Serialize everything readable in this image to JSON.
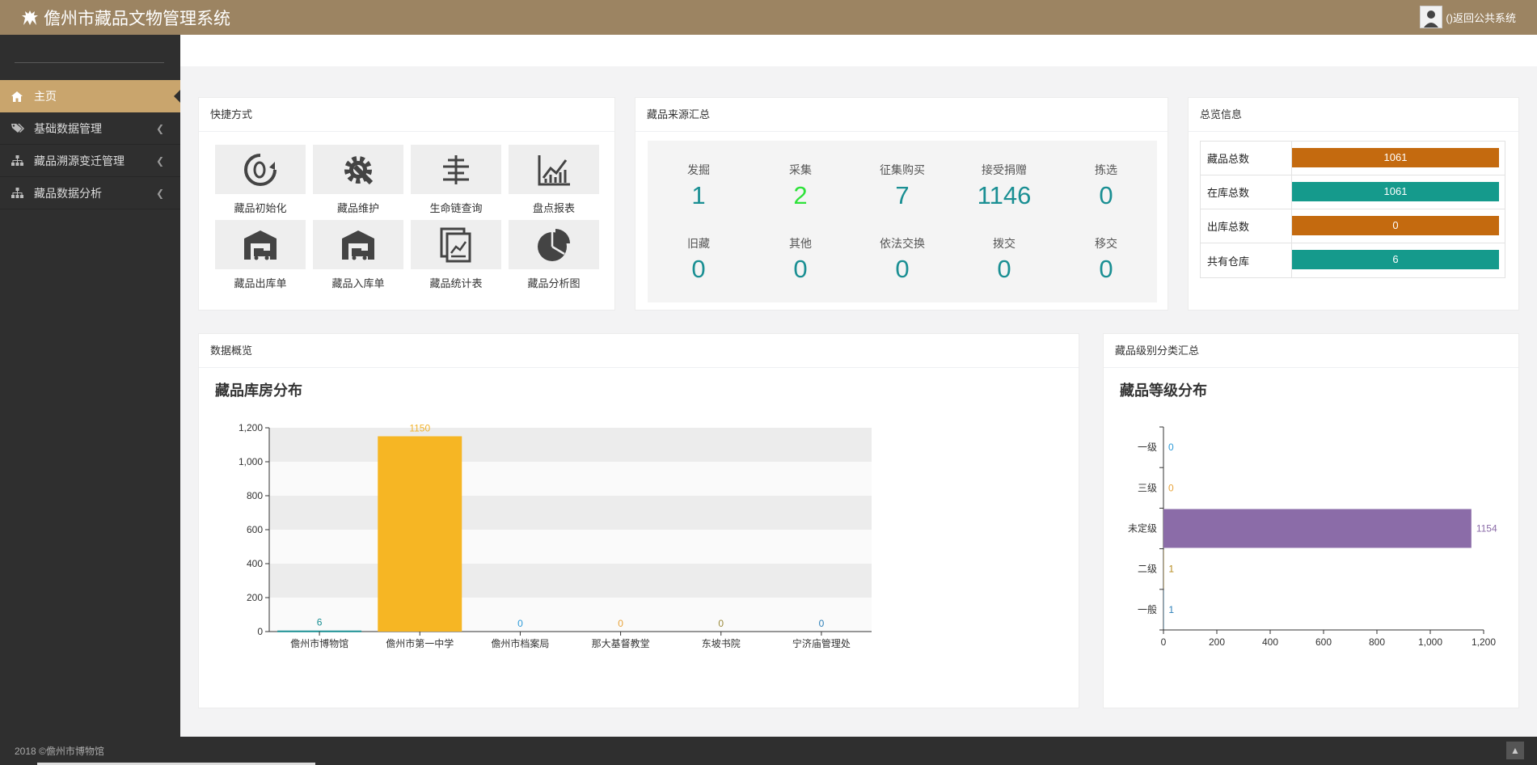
{
  "header": {
    "title": "儋州市藏品文物管理系统",
    "return_label": "()返回公共系统"
  },
  "sidebar": {
    "items": [
      {
        "label": "主页",
        "icon": "home-icon",
        "active": true
      },
      {
        "label": "基础数据管理",
        "icon": "tags-icon"
      },
      {
        "label": "藏品溯源变迁管理",
        "icon": "sitemap-icon"
      },
      {
        "label": "藏品数据分析",
        "icon": "sitemap-icon"
      }
    ]
  },
  "quick": {
    "title": "快捷方式",
    "items": [
      {
        "label": "藏品初始化",
        "icon": "reset-icon"
      },
      {
        "label": "藏品维护",
        "icon": "gear-wrench-icon"
      },
      {
        "label": "生命链查询",
        "icon": "align-center-icon"
      },
      {
        "label": "盘点报表",
        "icon": "line-chart-icon"
      },
      {
        "label": "藏品出库单",
        "icon": "warehouse-truck-icon"
      },
      {
        "label": "藏品入库单",
        "icon": "warehouse-truck-icon"
      },
      {
        "label": "藏品统计表",
        "icon": "documents-icon"
      },
      {
        "label": "藏品分析图",
        "icon": "pie-chart-icon"
      }
    ]
  },
  "source": {
    "title": "藏品来源汇总",
    "items": [
      {
        "label": "发掘",
        "value": "1"
      },
      {
        "label": "采集",
        "value": "2"
      },
      {
        "label": "征集购买",
        "value": "7"
      },
      {
        "label": "接受捐赠",
        "value": "1146"
      },
      {
        "label": "拣选",
        "value": "0"
      },
      {
        "label": "旧藏",
        "value": "0"
      },
      {
        "label": "其他",
        "value": "0"
      },
      {
        "label": "依法交换",
        "value": "0"
      },
      {
        "label": "拨交",
        "value": "0"
      },
      {
        "label": "移交",
        "value": "0"
      }
    ],
    "highlight_color": "#2ee23a",
    "value_color": "#1a8f93"
  },
  "overview": {
    "title": "总览信息",
    "rows": [
      {
        "label": "藏品总数",
        "value": "1061",
        "color": "#c46a0f"
      },
      {
        "label": "在库总数",
        "value": "1061",
        "color": "#159a8c"
      },
      {
        "label": "出库总数",
        "value": "0",
        "color": "#c46a0f"
      },
      {
        "label": "共有仓库",
        "value": "6",
        "color": "#159a8c"
      }
    ]
  },
  "data_overview": {
    "title": "数据概览",
    "chart_title": "藏品库房分布"
  },
  "level_summary": {
    "title": "藏品级别分类汇总",
    "chart_title": "藏品等级分布"
  },
  "chart_data": [
    {
      "type": "bar",
      "title": "藏品库房分布",
      "categories": [
        "儋州市博物馆",
        "儋州市第一中学",
        "儋州市档案局",
        "那大基督教堂",
        "东坡书院",
        "宁济庙管理处"
      ],
      "values": [
        6,
        1150,
        0,
        0,
        0,
        0
      ],
      "label_colors": [
        "#1a8f93",
        "#f2b32b",
        "#2c9ad8",
        "#e8a33a",
        "#9b8a3c",
        "#2c7fb8"
      ],
      "bar_colors": [
        "#1a8f93",
        "#f6b624",
        "#2c9ad8",
        "#e8a33a",
        "#9b8a3c",
        "#2c7fb8"
      ],
      "ylim": [
        0,
        1200
      ],
      "yticks": [
        "0",
        "200",
        "400",
        "600",
        "800",
        "1,000",
        "1,200"
      ]
    },
    {
      "type": "bar",
      "orientation": "horizontal",
      "title": "藏品等级分布",
      "categories": [
        "一级",
        "三级",
        "未定级",
        "二级",
        "一般"
      ],
      "values": [
        0,
        0,
        1154,
        1,
        1
      ],
      "label_colors": [
        "#2c9ad8",
        "#e8a33a",
        "#8b6ca8",
        "#b58a1a",
        "#2c7fb8"
      ],
      "bar_colors": [
        "#2c9ad8",
        "#e8a33a",
        "#8b6ca8",
        "#b58a1a",
        "#2c7fb8"
      ],
      "xlim": [
        0,
        1200
      ],
      "xticks": [
        "0",
        "200",
        "400",
        "600",
        "800",
        "1,000",
        "1,200"
      ]
    }
  ],
  "footer": {
    "text": "2018 ©儋州市博物馆",
    "top_icon": "chevron-up-icon"
  }
}
